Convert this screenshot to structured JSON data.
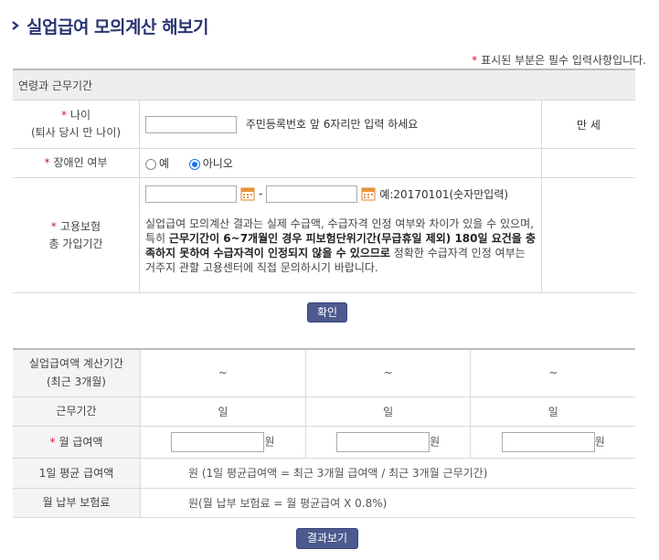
{
  "page": {
    "title": "실업급여 모의계산 해보기",
    "required_note": "표시된 부분은 필수 입력사항입니다."
  },
  "section": {
    "heading": "연령과 근무기간"
  },
  "age": {
    "label_line1": "나이",
    "label_line2": "(퇴사 당시 만 나이)",
    "value": "",
    "hint": "주민등록번호 앞 6자리만 입력 하세요",
    "result": "만 세"
  },
  "disability": {
    "label": "장애인 여부",
    "option_yes": "예",
    "option_no": "아니오",
    "selected": "아니오"
  },
  "insurance": {
    "label_line1": "고용보험",
    "label_line2": "총 가입기간",
    "start_value": "",
    "end_value": "",
    "separator": "-",
    "example": "예:20170101(숫자만입력)",
    "notice_1": "실업급여 모의계산 결과는 실제 수급액, 수급자격 인정 여부와 차이가 있을 수 있으며, 특히 ",
    "notice_bold": "근무기간이 6~7개월인 경우 피보험단위기간(무급휴일 제외) 180일 요건을 충족하지 못하여 수급자격이 인정되지 않을 수 있으므로",
    "notice_2": " 정확한 수급자격 인정 여부는 거주지 관할 고용센터에 직접 문의하시기 바랍니다."
  },
  "buttons": {
    "confirm": "확인",
    "result": "결과보기"
  },
  "calc": {
    "period_label_line1": "실업급여액 계산기간",
    "period_label_line2": "(최근 3개월)",
    "periods": [
      "~",
      "~",
      "~"
    ],
    "work_label": "근무기간",
    "work_days": [
      "일",
      "일",
      "일"
    ],
    "wage_label": "월 급여액",
    "wage_unit": "원",
    "wage_values": [
      "",
      "",
      ""
    ],
    "daily_label": "1일 평균 급여액",
    "daily_text": "원 (1일 평균급여액 = 최근 3개월 급여액 / 최근 3개월 근무기간)",
    "premium_label": "월 납부 보험료",
    "premium_text": "원(월 납부 보험료 = 월 평균급여 X 0.8%)"
  },
  "colors": {
    "title": "#2a3573",
    "required_star": "#d01b2a",
    "button": "#4c5a8f",
    "radio_selected": "#1a73e8"
  }
}
